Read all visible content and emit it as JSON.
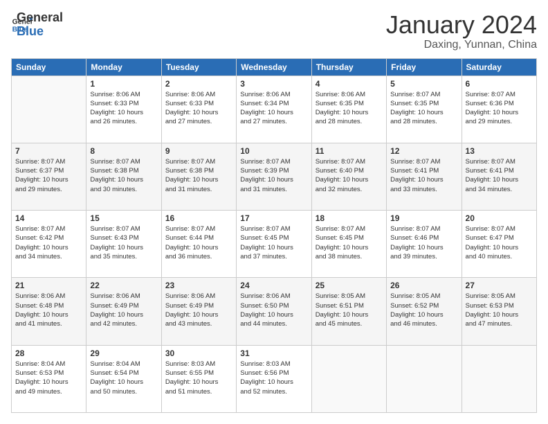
{
  "logo": {
    "line1": "General",
    "line2": "Blue"
  },
  "title": "January 2024",
  "location": "Daxing, Yunnan, China",
  "weekdays": [
    "Sunday",
    "Monday",
    "Tuesday",
    "Wednesday",
    "Thursday",
    "Friday",
    "Saturday"
  ],
  "days": [
    {
      "date": "",
      "info": ""
    },
    {
      "date": "1",
      "info": "Sunrise: 8:06 AM\nSunset: 6:33 PM\nDaylight: 10 hours\nand 26 minutes."
    },
    {
      "date": "2",
      "info": "Sunrise: 8:06 AM\nSunset: 6:33 PM\nDaylight: 10 hours\nand 27 minutes."
    },
    {
      "date": "3",
      "info": "Sunrise: 8:06 AM\nSunset: 6:34 PM\nDaylight: 10 hours\nand 27 minutes."
    },
    {
      "date": "4",
      "info": "Sunrise: 8:06 AM\nSunset: 6:35 PM\nDaylight: 10 hours\nand 28 minutes."
    },
    {
      "date": "5",
      "info": "Sunrise: 8:07 AM\nSunset: 6:35 PM\nDaylight: 10 hours\nand 28 minutes."
    },
    {
      "date": "6",
      "info": "Sunrise: 8:07 AM\nSunset: 6:36 PM\nDaylight: 10 hours\nand 29 minutes."
    },
    {
      "date": "7",
      "info": "Sunrise: 8:07 AM\nSunset: 6:37 PM\nDaylight: 10 hours\nand 29 minutes."
    },
    {
      "date": "8",
      "info": "Sunrise: 8:07 AM\nSunset: 6:38 PM\nDaylight: 10 hours\nand 30 minutes."
    },
    {
      "date": "9",
      "info": "Sunrise: 8:07 AM\nSunset: 6:38 PM\nDaylight: 10 hours\nand 31 minutes."
    },
    {
      "date": "10",
      "info": "Sunrise: 8:07 AM\nSunset: 6:39 PM\nDaylight: 10 hours\nand 31 minutes."
    },
    {
      "date": "11",
      "info": "Sunrise: 8:07 AM\nSunset: 6:40 PM\nDaylight: 10 hours\nand 32 minutes."
    },
    {
      "date": "12",
      "info": "Sunrise: 8:07 AM\nSunset: 6:41 PM\nDaylight: 10 hours\nand 33 minutes."
    },
    {
      "date": "13",
      "info": "Sunrise: 8:07 AM\nSunset: 6:41 PM\nDaylight: 10 hours\nand 34 minutes."
    },
    {
      "date": "14",
      "info": "Sunrise: 8:07 AM\nSunset: 6:42 PM\nDaylight: 10 hours\nand 34 minutes."
    },
    {
      "date": "15",
      "info": "Sunrise: 8:07 AM\nSunset: 6:43 PM\nDaylight: 10 hours\nand 35 minutes."
    },
    {
      "date": "16",
      "info": "Sunrise: 8:07 AM\nSunset: 6:44 PM\nDaylight: 10 hours\nand 36 minutes."
    },
    {
      "date": "17",
      "info": "Sunrise: 8:07 AM\nSunset: 6:45 PM\nDaylight: 10 hours\nand 37 minutes."
    },
    {
      "date": "18",
      "info": "Sunrise: 8:07 AM\nSunset: 6:45 PM\nDaylight: 10 hours\nand 38 minutes."
    },
    {
      "date": "19",
      "info": "Sunrise: 8:07 AM\nSunset: 6:46 PM\nDaylight: 10 hours\nand 39 minutes."
    },
    {
      "date": "20",
      "info": "Sunrise: 8:07 AM\nSunset: 6:47 PM\nDaylight: 10 hours\nand 40 minutes."
    },
    {
      "date": "21",
      "info": "Sunrise: 8:06 AM\nSunset: 6:48 PM\nDaylight: 10 hours\nand 41 minutes."
    },
    {
      "date": "22",
      "info": "Sunrise: 8:06 AM\nSunset: 6:49 PM\nDaylight: 10 hours\nand 42 minutes."
    },
    {
      "date": "23",
      "info": "Sunrise: 8:06 AM\nSunset: 6:49 PM\nDaylight: 10 hours\nand 43 minutes."
    },
    {
      "date": "24",
      "info": "Sunrise: 8:06 AM\nSunset: 6:50 PM\nDaylight: 10 hours\nand 44 minutes."
    },
    {
      "date": "25",
      "info": "Sunrise: 8:05 AM\nSunset: 6:51 PM\nDaylight: 10 hours\nand 45 minutes."
    },
    {
      "date": "26",
      "info": "Sunrise: 8:05 AM\nSunset: 6:52 PM\nDaylight: 10 hours\nand 46 minutes."
    },
    {
      "date": "27",
      "info": "Sunrise: 8:05 AM\nSunset: 6:53 PM\nDaylight: 10 hours\nand 47 minutes."
    },
    {
      "date": "28",
      "info": "Sunrise: 8:04 AM\nSunset: 6:53 PM\nDaylight: 10 hours\nand 49 minutes."
    },
    {
      "date": "29",
      "info": "Sunrise: 8:04 AM\nSunset: 6:54 PM\nDaylight: 10 hours\nand 50 minutes."
    },
    {
      "date": "30",
      "info": "Sunrise: 8:03 AM\nSunset: 6:55 PM\nDaylight: 10 hours\nand 51 minutes."
    },
    {
      "date": "31",
      "info": "Sunrise: 8:03 AM\nSunset: 6:56 PM\nDaylight: 10 hours\nand 52 minutes."
    },
    {
      "date": "",
      "info": ""
    },
    {
      "date": "",
      "info": ""
    },
    {
      "date": "",
      "info": ""
    },
    {
      "date": "",
      "info": ""
    }
  ]
}
